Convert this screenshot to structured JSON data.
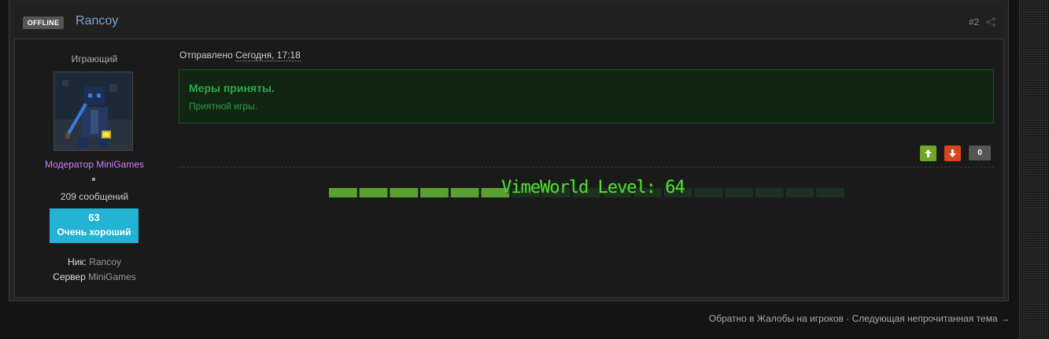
{
  "post": {
    "status_badge": "OFFLINE",
    "username": "Rancoy",
    "number": "#2",
    "sent_prefix": "Отправлено",
    "sent_date": "Сегодня, 17:18",
    "message_title": "Меры приняты.",
    "message_body": "Приятной игры.",
    "vote_count": "0",
    "signature": {
      "level_text": "VimeWorld Level: 64",
      "level_progress": 0.34
    }
  },
  "user": {
    "rank_title": "Играющий",
    "role": "Модератор MiniGames",
    "message_count": "209 сообщений",
    "reputation": {
      "value": "63",
      "label": "Очень хороший"
    },
    "nick_label": "Ник:",
    "nick_value": "Rancoy",
    "server_label": "Сервер",
    "server_value": "MiniGames"
  },
  "footer": {
    "back_link": "Обратно в Жалобы на игроков",
    "separator": "·",
    "next_link": "Следующая непрочитанная тема",
    "next_arrow": "→"
  },
  "icons": {
    "share": "share-icon",
    "vote_up": "arrow-up-icon",
    "vote_down": "arrow-down-icon"
  },
  "colors": {
    "username": "#7aa7d8",
    "role": "#d07cff",
    "reputation_bg": "#23b4d4",
    "message_text": "#2ea84a",
    "vote_up": "#6fa824",
    "vote_down": "#d8461b",
    "level_text": "#55d83a"
  }
}
